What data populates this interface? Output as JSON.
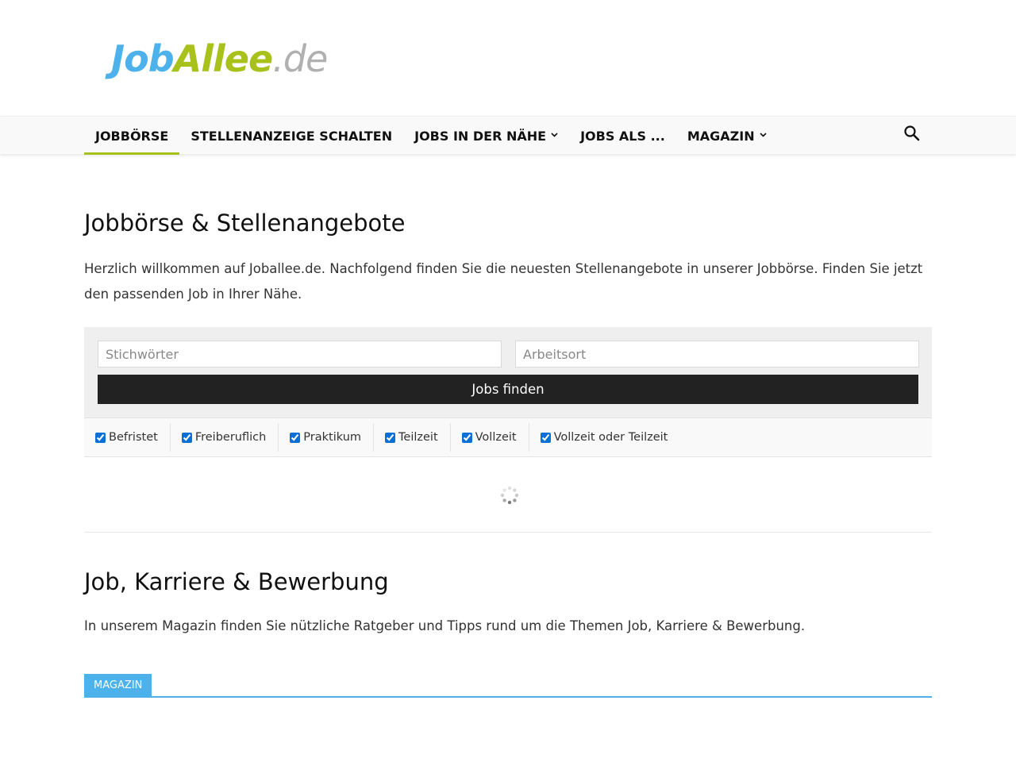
{
  "logo": {
    "part1": "Job",
    "part2": "Allee",
    "part3": ".de"
  },
  "nav": {
    "items": [
      {
        "label": "JOBBÖRSE",
        "has_dropdown": false,
        "active": true
      },
      {
        "label": "STELLENANZEIGE SCHALTEN",
        "has_dropdown": false
      },
      {
        "label": "JOBS IN DER NÄHE",
        "has_dropdown": true
      },
      {
        "label": "JOBS ALS ...",
        "has_dropdown": false
      },
      {
        "label": "MAGAZIN",
        "has_dropdown": true
      }
    ],
    "search_icon": "search-icon"
  },
  "page": {
    "title": "Jobbörse & Stellenangebote",
    "intro": "Herzlich willkommen auf Joballee.de. Nachfolgend finden Sie die neuesten Stellenangebote in unserer Jobbörse. Finden Sie jetzt den passenden Job in Ihrer Nähe."
  },
  "search": {
    "keywords_placeholder": "Stichwörter",
    "location_placeholder": "Arbeitsort",
    "button_label": "Jobs finden",
    "filters": [
      {
        "label": "Befristet",
        "checked": true
      },
      {
        "label": "Freiberuflich",
        "checked": true
      },
      {
        "label": "Praktikum",
        "checked": true
      },
      {
        "label": "Teilzeit",
        "checked": true
      },
      {
        "label": "Vollzeit",
        "checked": true
      },
      {
        "label": "Vollzeit oder Teilzeit",
        "checked": true
      }
    ]
  },
  "magazine": {
    "title": "Job, Karriere & Bewerbung",
    "intro": "In unserem Magazin finden Sie nützliche Ratgeber und Tipps rund um die Themen Job, Karriere & Bewerbung.",
    "block_tag": "MAGAZIN"
  },
  "colors": {
    "brand_blue": "#4db2ec",
    "brand_green": "#a9c21b",
    "brand_gray": "#b0b0b0",
    "button_dark": "#222222"
  }
}
